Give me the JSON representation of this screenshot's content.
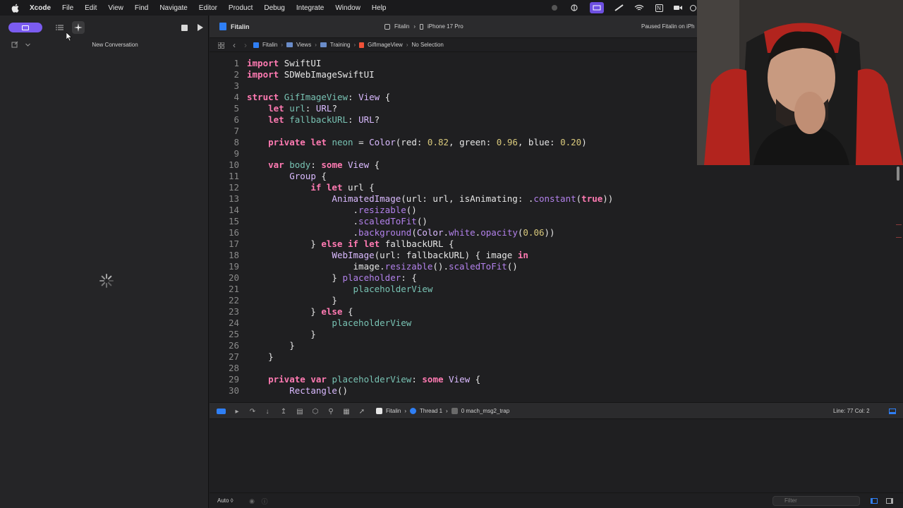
{
  "menubar": {
    "apple_icon": "apple-icon",
    "app_name": "Xcode",
    "items": [
      "File",
      "Edit",
      "View",
      "Find",
      "Navigate",
      "Editor",
      "Product",
      "Debug",
      "Integrate",
      "Window",
      "Help"
    ]
  },
  "left_panel": {
    "conversation_title": "New Conversation"
  },
  "tabbar": {
    "scheme": "Fitalin",
    "destination_project": "Fitalin",
    "destination_device": "iPhone 17 Pro",
    "status": "Paused Fitalin on iPh"
  },
  "jumpbar": {
    "crumbs": [
      "Fitalin",
      "Views",
      "Training",
      "GifImageView",
      "No Selection"
    ]
  },
  "code": {
    "line_numbers": [
      "1",
      "2",
      "3",
      "4",
      "5",
      "6",
      "7",
      "8",
      "9",
      "10",
      "11",
      "12",
      "13",
      "14",
      "15",
      "16",
      "17",
      "18",
      "19",
      "20",
      "21",
      "22",
      "23",
      "24",
      "25",
      "26",
      "27",
      "28",
      "29",
      "30"
    ]
  },
  "debugbar": {
    "crumbs": [
      "Fitalin",
      "Thread 1",
      "0 mach_msg2_trap"
    ],
    "line_col": "Line: 77  Col: 2"
  },
  "bottombar": {
    "auto_label": "Auto ◊",
    "filter_placeholder": "Filter"
  },
  "colors": {
    "accent": "#7b5cf0",
    "keyword": "#ff7ab2",
    "type": "#dabaff",
    "identifier": "#78c2b3",
    "number": "#d9c97c"
  }
}
